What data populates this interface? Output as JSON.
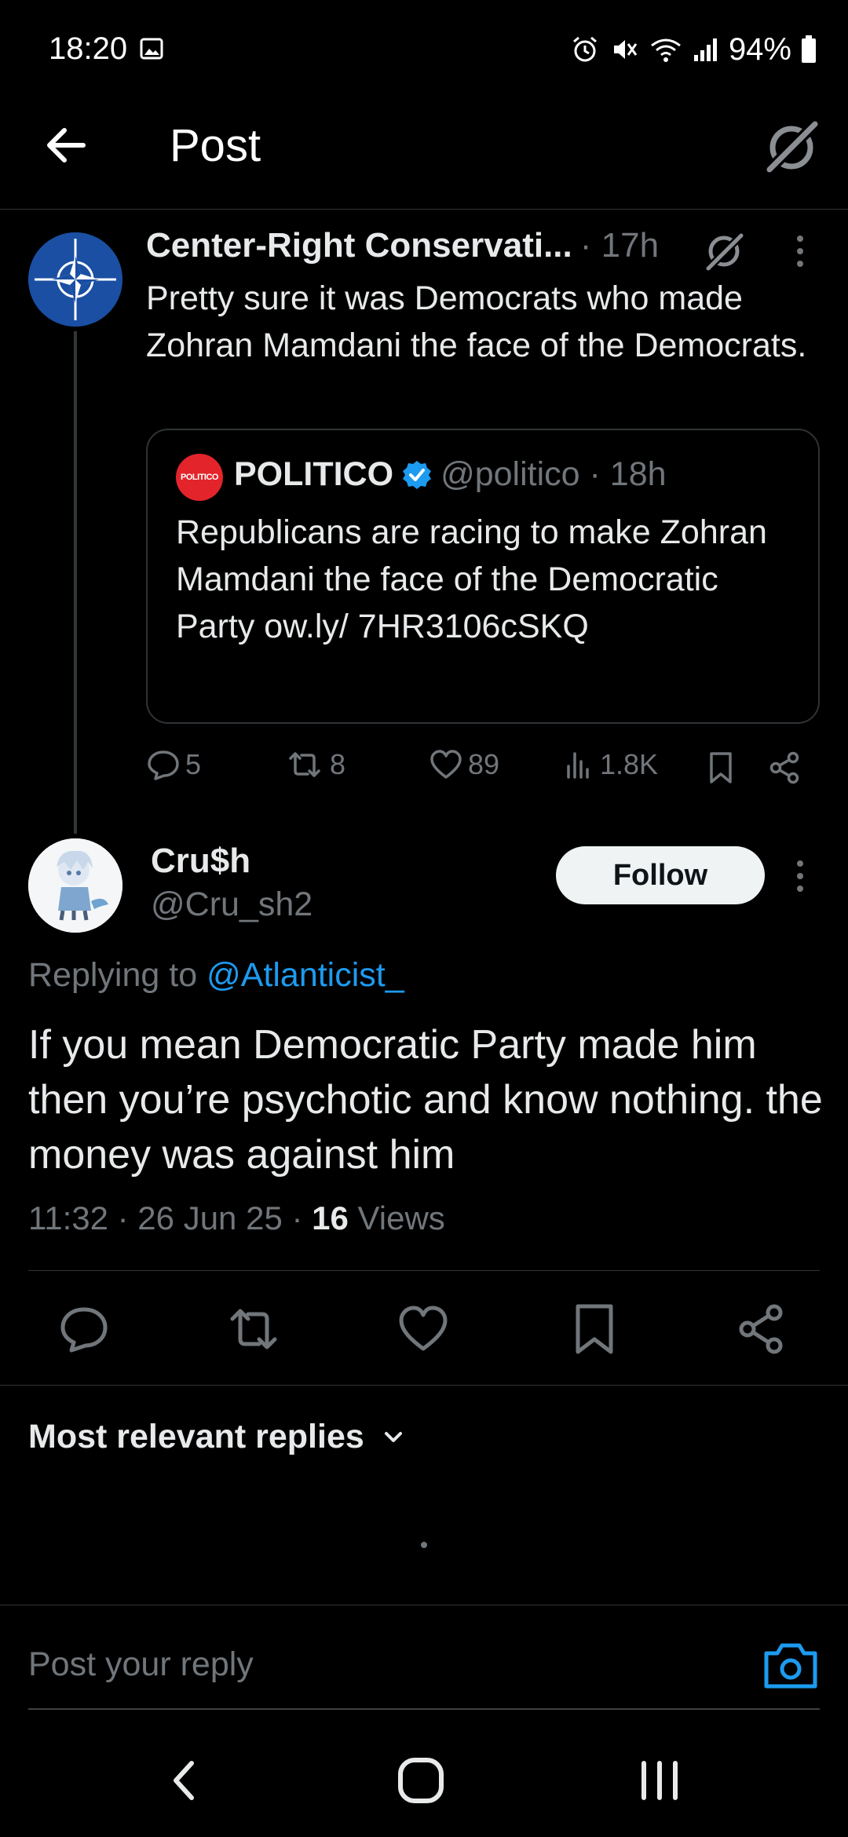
{
  "status_bar": {
    "time": "18:20",
    "battery": "94%"
  },
  "header": {
    "title": "Post"
  },
  "parent_post": {
    "author_name": "Center-Right Conservati...",
    "time": "· 17h",
    "text": "Pretty sure it was Democrats who made Zohran Mamdani the face of the Democrats.",
    "quote": {
      "avatar_text": "POLITICO",
      "author_name": "POLITICO",
      "handle_time": "@politico · 18h",
      "text": "Republicans are racing to make Zohran Mamdani the face of the Democratic Party ow.ly/ 7HR3106cSKQ"
    },
    "stats": {
      "replies": "5",
      "reposts": "8",
      "likes": "89",
      "views": "1.8K"
    }
  },
  "main_post": {
    "author_name": "Cru$h",
    "handle": "@Cru_sh2",
    "follow_label": "Follow",
    "replying_prefix": "Replying to ",
    "replying_to": "@Atlanticist_",
    "text": "If you mean Democratic Party made him then you’re psychotic and know nothing. the money was against him",
    "timestamp": "11:32 · 26 Jun 25 · ",
    "views_count": "16",
    "views_label": " Views"
  },
  "replies": {
    "sort_label": "Most relevant replies"
  },
  "composer": {
    "placeholder": "Post your reply"
  },
  "colors": {
    "background": "#000000",
    "text_primary": "#e7e9ea",
    "text_secondary": "#71767b",
    "accent": "#1d9bf0",
    "divider": "#2f3336",
    "politico_red": "#e3242b"
  },
  "icons": [
    "back-arrow-icon",
    "grok-icon",
    "more-vertical-icon",
    "verified-badge-icon",
    "reply-icon",
    "repost-icon",
    "like-icon",
    "views-icon",
    "bookmark-icon",
    "share-icon",
    "chevron-down-icon",
    "camera-icon",
    "nav-back-icon",
    "nav-home-icon",
    "nav-recents-icon"
  ]
}
